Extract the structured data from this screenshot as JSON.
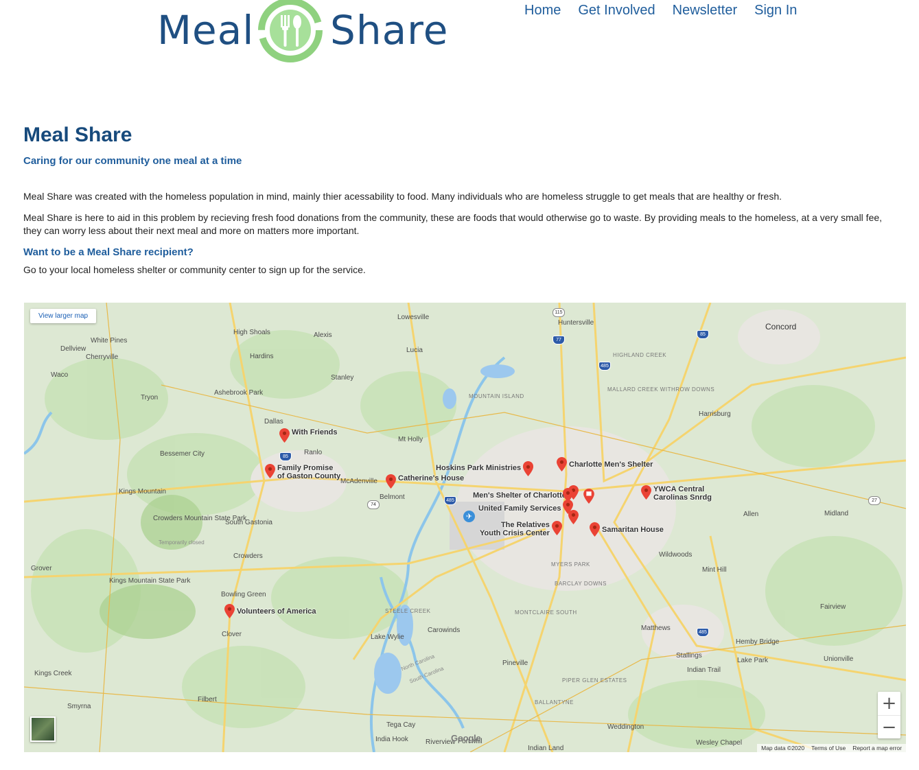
{
  "logo": {
    "word_left": "Meal",
    "word_right": "Share"
  },
  "nav": [
    "Home",
    "Get Involved",
    "Newsletter",
    "Sign In"
  ],
  "page": {
    "title": "Meal Share",
    "tagline": "Caring for our community one meal at a time",
    "p1": "Meal Share was created with the homeless population in mind, mainly thier acessability to food. Many individuals who are homeless struggle to get meals that are healthy or fresh.",
    "p2": "Meal Share is here to aid in this problem by recieving fresh food donations from the community, these are foods that would otherwise go to waste. By providing meals to the homeless, at a very small fee, they can worry less about their next meal and more on matters more important.",
    "recipient_heading": "Want to be a Meal Share recipient?",
    "recipient_text": "Go to your local homeless shelter or community center to sign up for the service."
  },
  "map": {
    "view_larger": "View larger map",
    "zoom_in": "+",
    "zoom_out": "−",
    "google": "Google",
    "attribution": [
      "Map data ©2020",
      "Terms of Use",
      "Report a map error"
    ],
    "markers": [
      {
        "label": "With Friends"
      },
      {
        "label": "Family Promise\nof Gaston County"
      },
      {
        "label": "Catherine's House"
      },
      {
        "label": "Hoskins Park Ministries"
      },
      {
        "label": "Charlotte Men's Shelter"
      },
      {
        "label": "Men's Shelter of Charlotte"
      },
      {
        "label": "United Family Services"
      },
      {
        "label": "The Relatives\nYouth Crisis Center"
      },
      {
        "label": "YWCA Central\nCarolinas Snrdg"
      },
      {
        "label": "Samaritan House"
      },
      {
        "label": "Volunteers of America"
      }
    ],
    "places": [
      "Lowesville",
      "Huntersville",
      "Concord",
      "White Pines",
      "High Shoals",
      "Alexis",
      "Dellview",
      "Cherryville",
      "Hardins",
      "Lucia",
      "Stanley",
      "Waco",
      "Ashebrook Park",
      "Tryon",
      "Mountain Island",
      "Highland Creek",
      "Mallard Creek Withrow Downs",
      "Harrisburg",
      "Dallas",
      "Ranlo",
      "Mt Holly",
      "Bessemer City",
      "McAdenville",
      "Belmont",
      "Kings Mountain",
      "Crowders Mountain State Park",
      "Temporarily closed",
      "South Gastonia",
      "Crowders",
      "Allen",
      "Midland",
      "Grover",
      "Kings Mountain State Park",
      "Wildwoods",
      "Mint Hill",
      "Myers Park",
      "Barclay Downs",
      "Montclaire South",
      "Bowling Green",
      "Clover",
      "Lake Wylie",
      "Steele Creek",
      "Carowinds",
      "Fairview",
      "Matthews",
      "Stallings",
      "Hemby Bridge",
      "Lake Park",
      "Unionville",
      "Indian Trail",
      "Pineville",
      "Piper Glen Estates",
      "Ballantyne",
      "Kings Creek",
      "Smyrna",
      "Filbert",
      "Tega Cay",
      "India Hook",
      "Riverview",
      "Fort Mill",
      "Weddington",
      "Wesley Chapel",
      "Indian Land",
      "North Carolina",
      "South Carolina"
    ]
  }
}
